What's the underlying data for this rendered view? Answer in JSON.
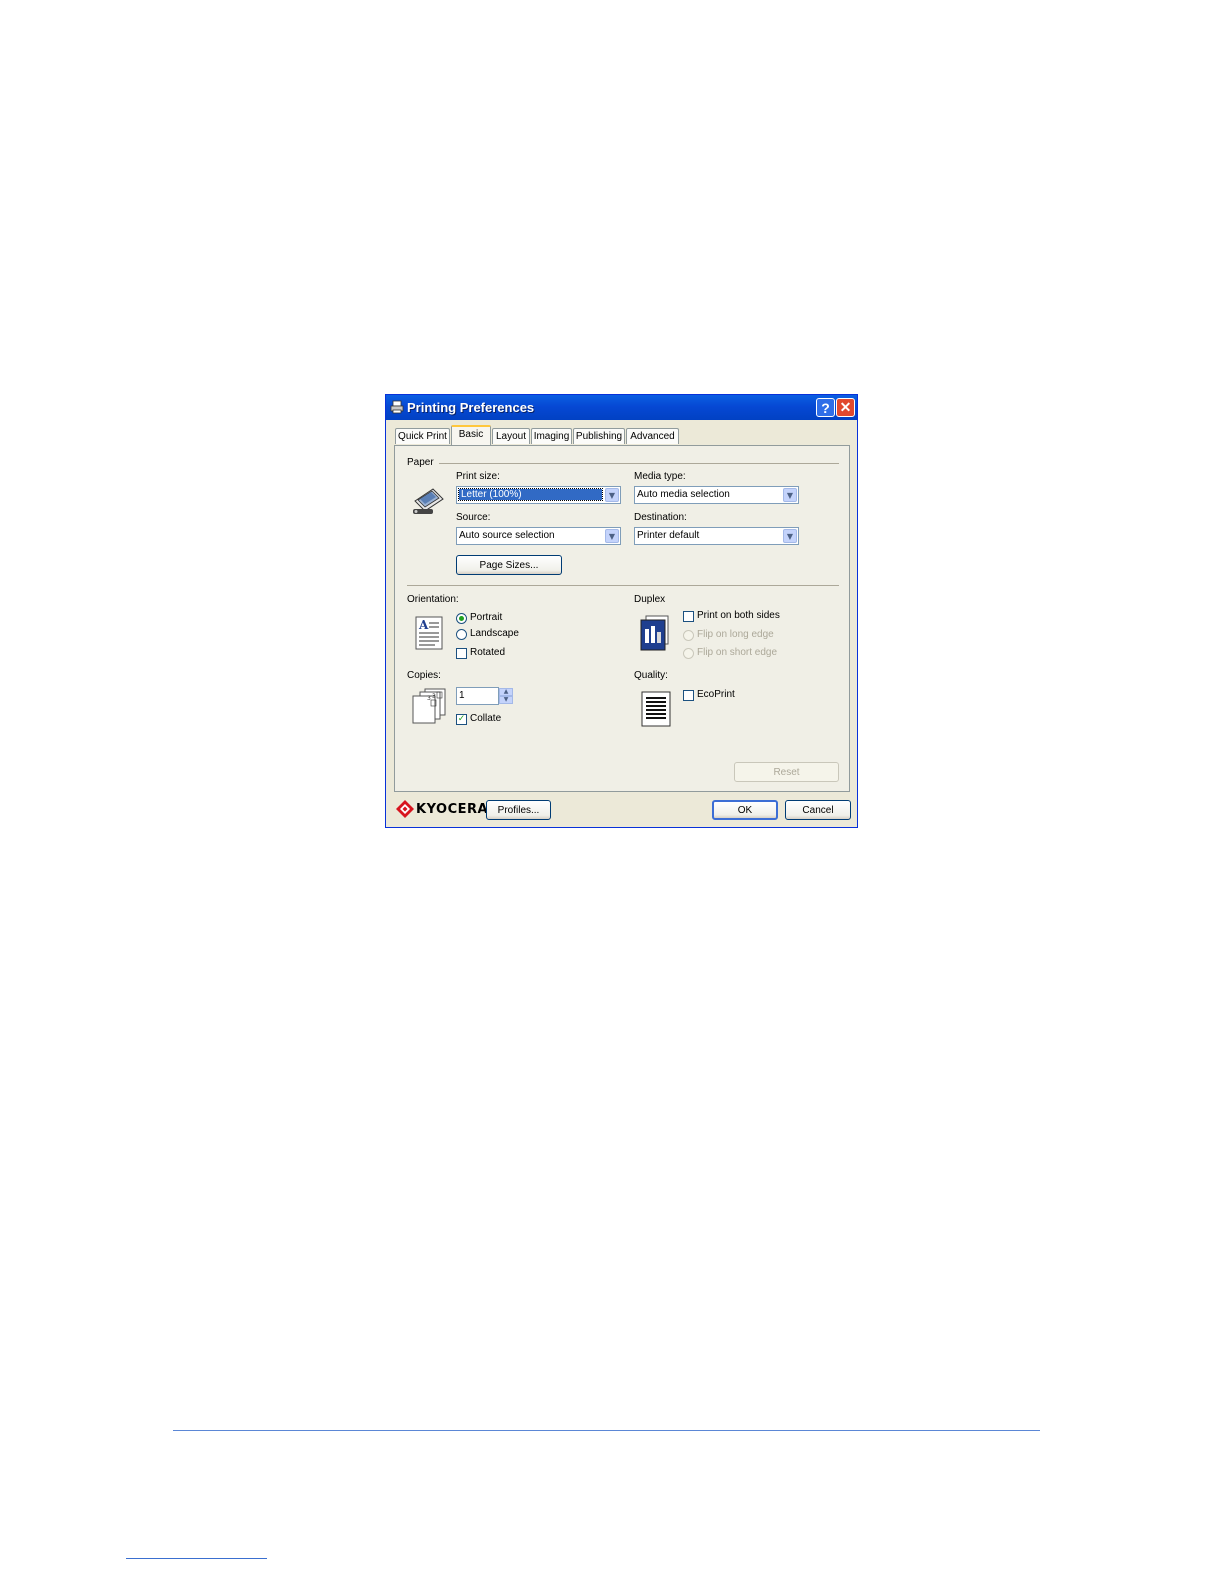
{
  "dialog": {
    "title": "Printing Preferences",
    "help_glyph": "?",
    "close_glyph": "✕"
  },
  "tabs": [
    {
      "label": "Quick Print",
      "active": false
    },
    {
      "label": "Basic",
      "active": true
    },
    {
      "label": "Layout",
      "active": false
    },
    {
      "label": "Imaging",
      "active": false
    },
    {
      "label": "Publishing",
      "active": false
    },
    {
      "label": "Advanced",
      "active": false
    }
  ],
  "paper": {
    "group_label": "Paper",
    "print_size_label": "Print size:",
    "print_size_value": "Letter (100%)",
    "media_type_label": "Media type:",
    "media_type_value": "Auto media selection",
    "source_label": "Source:",
    "source_value": "Auto source selection",
    "destination_label": "Destination:",
    "destination_value": "Printer default",
    "page_sizes_button": "Page Sizes..."
  },
  "orientation": {
    "label": "Orientation:",
    "portrait": "Portrait",
    "landscape": "Landscape",
    "rotated": "Rotated",
    "selected": "portrait",
    "rotated_checked": false
  },
  "duplex": {
    "label": "Duplex",
    "print_both_sides": "Print on both sides",
    "flip_long": "Flip on long edge",
    "flip_short": "Flip on short edge",
    "print_both_sides_checked": false
  },
  "copies": {
    "label": "Copies:",
    "value": "1",
    "collate": "Collate",
    "collate_checked": true
  },
  "quality": {
    "label": "Quality:",
    "ecoprint": "EcoPrint",
    "ecoprint_checked": false
  },
  "buttons": {
    "reset": "Reset",
    "profiles": "Profiles...",
    "ok": "OK",
    "cancel": "Cancel"
  },
  "brand": {
    "name": "KYOCERA"
  },
  "colors": {
    "titlebar": "#0648d4",
    "dialog_bg": "#ece9d8",
    "brand_red": "#d7141e",
    "page_rule": "#5b87d6"
  }
}
